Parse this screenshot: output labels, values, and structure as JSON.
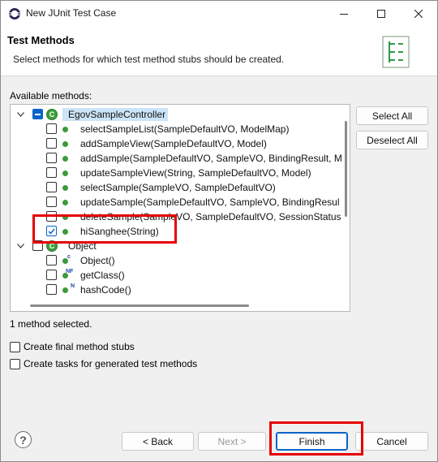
{
  "window": {
    "title": "New JUnit Test Case"
  },
  "header": {
    "title": "Test Methods",
    "description": "Select methods for which test method stubs should be created."
  },
  "tree": {
    "label": "Available methods:",
    "class1": {
      "name": "EgovSampleController"
    },
    "methods1": [
      {
        "label": "selectSampleList(SampleDefaultVO, ModelMap)",
        "checked": false
      },
      {
        "label": "addSampleView(SampleDefaultVO, Model)",
        "checked": false
      },
      {
        "label": "addSample(SampleDefaultVO, SampleVO, BindingResult, M",
        "checked": false
      },
      {
        "label": "updateSampleView(String, SampleDefaultVO, Model)",
        "checked": false
      },
      {
        "label": "selectSample(SampleVO, SampleDefaultVO)",
        "checked": false
      },
      {
        "label": "updateSample(SampleDefaultVO, SampleVO, BindingResul",
        "checked": false
      },
      {
        "label": "deleteSample(SampleVO, SampleDefaultVO, SessionStatus",
        "checked": false
      },
      {
        "label": "hiSanghee(String)",
        "checked": true
      }
    ],
    "class2": {
      "name": "Object"
    },
    "methods2": [
      {
        "label": "Object()",
        "badge": "c"
      },
      {
        "label": "getClass()",
        "badge": "NF"
      },
      {
        "label": "hashCode()",
        "badge": "N"
      }
    ]
  },
  "buttons": {
    "select_all": "Select All",
    "deselect_all": "Deselect All",
    "back": "< Back",
    "next": "Next >",
    "finish": "Finish",
    "cancel": "Cancel"
  },
  "status": "1 method selected.",
  "options": {
    "final_stubs": "Create final method stubs",
    "tasks": "Create tasks for generated test methods"
  },
  "colors": {
    "accent": "#0a64c8",
    "highlight": "#e60000",
    "method_icon": "#3c9a3c"
  }
}
